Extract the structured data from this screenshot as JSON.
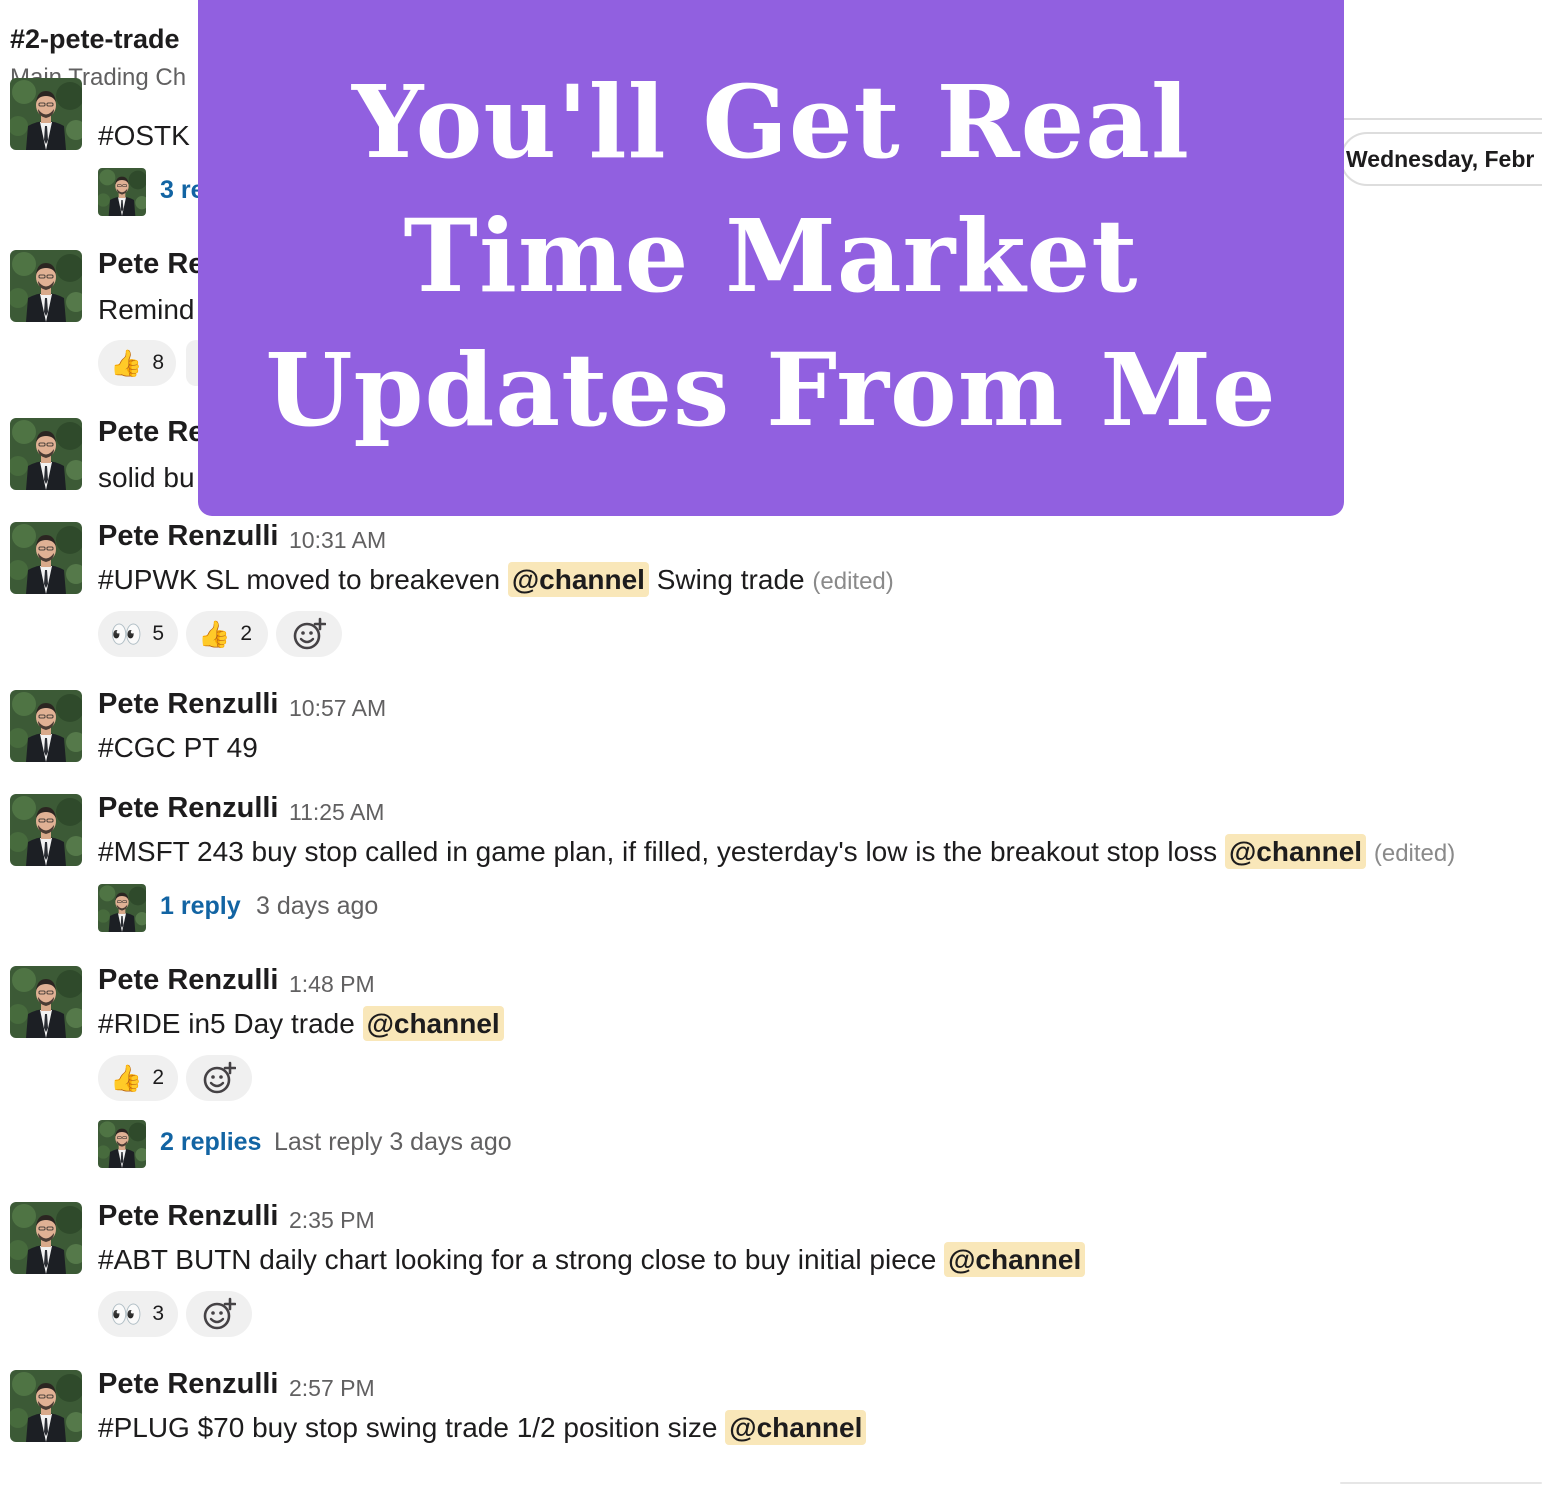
{
  "channel": {
    "name": "#2-pete-trade",
    "topic": "Main Trading Ch"
  },
  "date_divider": "Wednesday, Febr",
  "overlay": {
    "line1": "You'll Get Real",
    "line2": "Time Market",
    "line3": "Updates From Me"
  },
  "messages": [
    {
      "text": "#OSTK",
      "thread": {
        "link": "3 re"
      }
    },
    {
      "author": "Pete Re",
      "text": "Remind",
      "reactions": [
        {
          "emoji": "👍",
          "count": "8"
        }
      ]
    },
    {
      "author": "Pete Re",
      "text": "solid bu"
    },
    {
      "author": "Pete Renzulli",
      "time": "10:31 AM",
      "text_before": "#UPWK SL moved to breakeven",
      "mention": "@channel",
      "text_after": "Swing trade",
      "edited": "(edited)",
      "reactions": [
        {
          "emoji": "👀",
          "count": "5"
        },
        {
          "emoji": "👍",
          "count": "2"
        }
      ]
    },
    {
      "author": "Pete Renzulli",
      "time": "10:57 AM",
      "text": "#CGC PT 49"
    },
    {
      "author": "Pete Renzulli",
      "time": "11:25 AM",
      "text_before": "#MSFT 243 buy stop called in game plan, if filled, yesterday's low is the breakout stop loss",
      "mention": "@channel",
      "edited": "(edited)",
      "thread": {
        "link": "1 reply",
        "meta": "3 days ago"
      }
    },
    {
      "author": "Pete Renzulli",
      "time": "1:48 PM",
      "text_before": "#RIDE in5 Day trade",
      "mention": "@channel",
      "reactions": [
        {
          "emoji": "👍",
          "count": "2"
        }
      ],
      "thread": {
        "link": "2 replies",
        "meta": "Last reply 3 days ago"
      }
    },
    {
      "author": "Pete Renzulli",
      "time": "2:35 PM",
      "text_before": "#ABT BUTN daily chart looking for a strong close to buy initial piece",
      "mention": "@channel",
      "reactions": [
        {
          "emoji": "👀",
          "count": "3"
        }
      ]
    },
    {
      "author": "Pete Renzulli",
      "time": "2:57 PM",
      "text_before": "#PLUG $70 buy stop swing trade 1/2 position size",
      "mention": "@channel"
    }
  ],
  "icons": {
    "add_reaction": "add-reaction-icon",
    "avatar": "avatar-photo"
  },
  "colors": {
    "overlay": "#9160e0",
    "mention_bg": "#f9e7b9",
    "link": "#1264a3",
    "reaction_bg": "#f0f0f0"
  }
}
